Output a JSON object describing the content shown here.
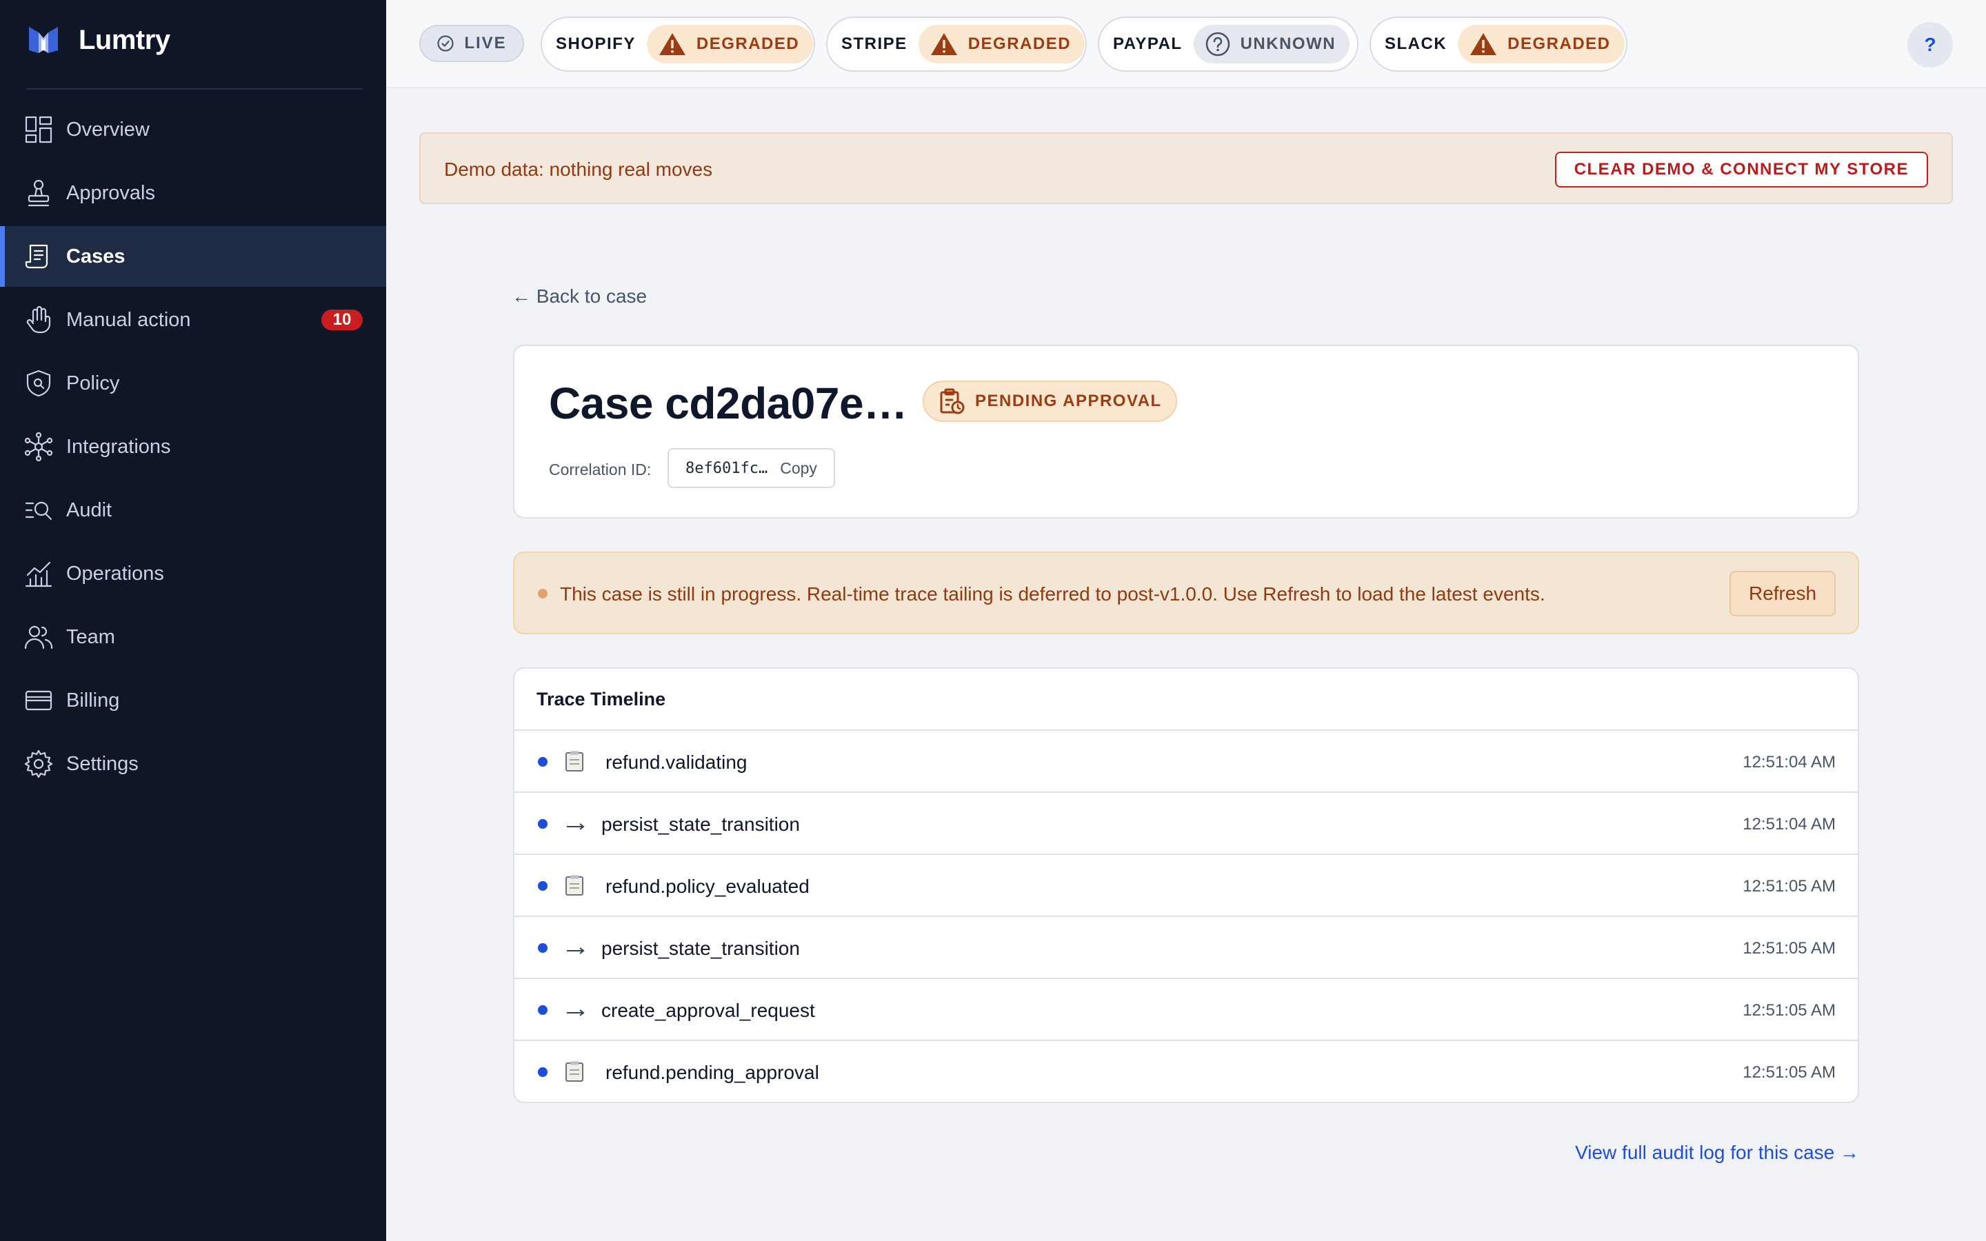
{
  "app": {
    "brand_name": "Lumtry"
  },
  "sidebar": {
    "items": [
      {
        "label": "Overview",
        "icon": "overview-icon"
      },
      {
        "label": "Approvals",
        "icon": "stamp-icon"
      },
      {
        "label": "Cases",
        "icon": "cases-icon",
        "active": true
      },
      {
        "label": "Manual action",
        "icon": "hand-icon",
        "badge": "10"
      },
      {
        "label": "Policy",
        "icon": "shield-icon"
      },
      {
        "label": "Integrations",
        "icon": "network-icon"
      },
      {
        "label": "Audit",
        "icon": "audit-search-icon"
      },
      {
        "label": "Operations",
        "icon": "chart-icon"
      },
      {
        "label": "Team",
        "icon": "team-icon"
      },
      {
        "label": "Billing",
        "icon": "card-icon"
      },
      {
        "label": "Settings",
        "icon": "gear-icon"
      }
    ]
  },
  "topbar": {
    "live_label": "LIVE",
    "integrations": [
      {
        "name": "SHOPIFY",
        "status": "DEGRADED",
        "state": "degraded"
      },
      {
        "name": "STRIPE",
        "status": "DEGRADED",
        "state": "degraded"
      },
      {
        "name": "PAYPAL",
        "status": "UNKNOWN",
        "state": "unknown"
      },
      {
        "name": "SLACK",
        "status": "DEGRADED",
        "state": "degraded"
      }
    ],
    "help_label": "?"
  },
  "demo_banner": {
    "text": "Demo data: nothing real moves",
    "button_label": "CLEAR DEMO & CONNECT MY STORE"
  },
  "main": {
    "back_link": "← Back to case",
    "case_title": "Case cd2da07e…",
    "status_badge": "PENDING APPROVAL",
    "correlation_label": "Correlation ID:",
    "correlation_value": "8ef601fc…",
    "copy_label": "Copy",
    "progress_text": "This case is still in progress. Real-time trace tailing is deferred to post-v1.0.0. Use Refresh to load the latest events.",
    "refresh_label": "Refresh",
    "timeline_title": "Trace Timeline",
    "events": [
      {
        "icon": "clipboard",
        "label": "refund.validating",
        "time": "12:51:04 AM"
      },
      {
        "icon": "arrow",
        "label": "persist_state_transition",
        "time": "12:51:04 AM"
      },
      {
        "icon": "clipboard",
        "label": "refund.policy_evaluated",
        "time": "12:51:05 AM"
      },
      {
        "icon": "arrow",
        "label": "persist_state_transition",
        "time": "12:51:05 AM"
      },
      {
        "icon": "arrow",
        "label": "create_approval_request",
        "time": "12:51:05 AM"
      },
      {
        "icon": "clipboard",
        "label": "refund.pending_approval",
        "time": "12:51:05 AM"
      }
    ],
    "audit_link": "View full audit log for this case →"
  },
  "colors": {
    "sidebar_bg": "#0e1628",
    "accent": "#4f7bf0",
    "degraded": "#9a3d12",
    "link": "#1d4ed8",
    "badge_red": "#c81e1e"
  }
}
